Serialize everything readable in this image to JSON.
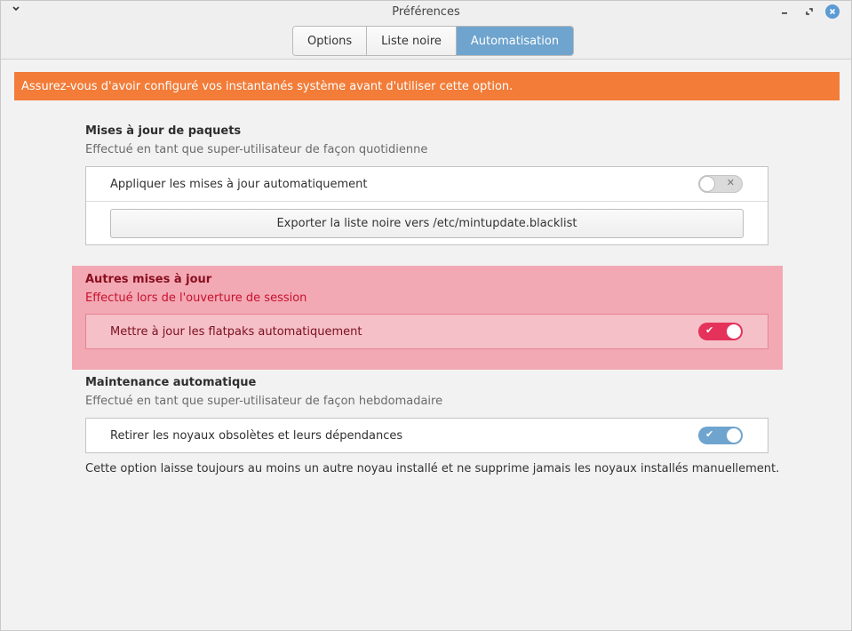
{
  "window": {
    "title": "Préférences"
  },
  "tabs": [
    {
      "label": "Options",
      "active": false
    },
    {
      "label": "Liste noire",
      "active": false
    },
    {
      "label": "Automatisation",
      "active": true
    }
  ],
  "banner": {
    "text": "Assurez-vous d'avoir configuré vos instantanés système avant d'utiliser cette option.",
    "color": "#f27c38"
  },
  "packages": {
    "title": "Mises à jour de paquets",
    "subtitle": "Effectué en tant que super-utilisateur de façon quotidienne",
    "auto_label": "Appliquer les mises à jour automatiquement",
    "auto_enabled": false,
    "export_label": "Exporter la liste noire vers /etc/mintupdate.blacklist"
  },
  "other": {
    "title": "Autres mises à jour",
    "subtitle": "Effectué lors de l'ouverture de session",
    "flatpak_label": "Mettre à jour les flatpaks automatiquement",
    "flatpak_enabled": true
  },
  "maintenance": {
    "title": "Maintenance automatique",
    "subtitle": "Effectué en tant que super-utilisateur de façon hebdomadaire",
    "kernels_label": "Retirer les noyaux obsolètes et leurs dépendances",
    "kernels_enabled": true,
    "note": "Cette option laisse toujours au moins un autre noyau installé et ne supprime jamais les noyaux installés manuellement."
  },
  "colors": {
    "accent": "#6ea4ce",
    "highlight_bg": "#f2a9b4",
    "toggle_red": "#e5325a"
  },
  "icons": {
    "menu": "chevron-down-icon",
    "minimize": "minimize-icon",
    "maximize": "maximize-icon",
    "close": "close-icon",
    "check": "check-icon",
    "cross": "cross-icon"
  }
}
